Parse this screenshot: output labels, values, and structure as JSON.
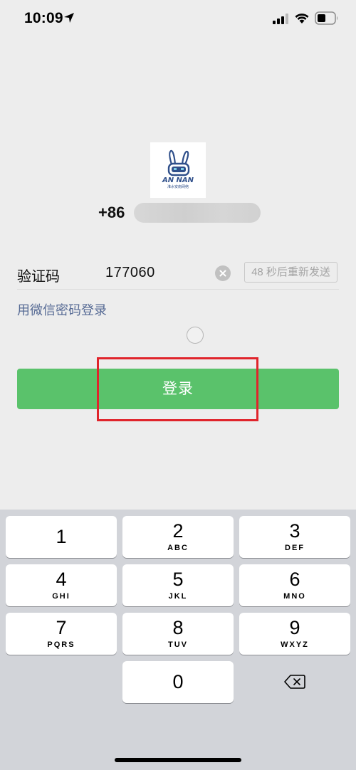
{
  "status_bar": {
    "time": "10:09",
    "icons": [
      "location-arrow-icon",
      "signal-icon",
      "wifi-icon",
      "battery-icon"
    ]
  },
  "account": {
    "avatar_logo_text": "AN NAN",
    "avatar_logo_subtitle": "淮水安南网络",
    "country_code": "+86"
  },
  "verification": {
    "label": "验证码",
    "code_value": "177060",
    "resend_label": "48 秒后重新发送"
  },
  "links": {
    "password_login": "用微信密码登录"
  },
  "actions": {
    "login_label": "登录"
  },
  "keypad": {
    "keys": [
      {
        "digit": "1",
        "letters": ""
      },
      {
        "digit": "2",
        "letters": "ABC"
      },
      {
        "digit": "3",
        "letters": "DEF"
      },
      {
        "digit": "4",
        "letters": "GHI"
      },
      {
        "digit": "5",
        "letters": "JKL"
      },
      {
        "digit": "6",
        "letters": "MNO"
      },
      {
        "digit": "7",
        "letters": "PQRS"
      },
      {
        "digit": "8",
        "letters": "TUV"
      },
      {
        "digit": "9",
        "letters": "WXYZ"
      },
      {
        "digit": "0",
        "letters": ""
      }
    ]
  },
  "colors": {
    "primary_green": "#5ac26b",
    "link_blue": "#576b95",
    "highlight_red": "#e0242b",
    "background": "#ededed",
    "keypad_background": "#d2d4d9"
  }
}
